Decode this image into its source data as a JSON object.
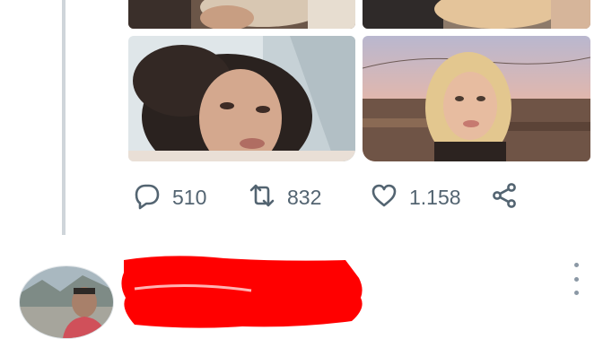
{
  "tweet": {
    "stats": {
      "replies": "510",
      "retweets": "832",
      "likes": "1.158"
    },
    "icons": {
      "reply": "speech-bubble-icon",
      "retweet": "retweet-icon",
      "like": "heart-icon",
      "share": "share-icon"
    }
  },
  "next_tweet": {
    "author_name_redacted": true,
    "menu_icon": "more-vertical-icon"
  },
  "colors": {
    "icon_gray": "#536471",
    "thread_line": "#cfd5da",
    "redaction": "#ff0000"
  }
}
